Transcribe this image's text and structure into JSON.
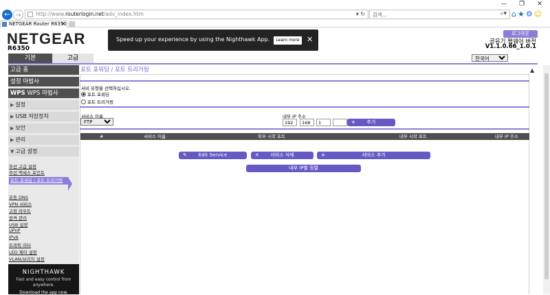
{
  "browser": {
    "url_prefix": "http://www.",
    "url_host": "routerlogin.net",
    "url_path": "/adv_index.htm",
    "search_placeholder": "검색...",
    "tab_title": "NETGEAR Router R6350"
  },
  "header": {
    "logo": "NETGEAR",
    "model": "R6350",
    "banner_text": "Speed up your experience by using the Nighthawk App.",
    "learn_more": "Learn more",
    "logout": "로그아웃",
    "firmware_label": "공유기 펌웨어 버전",
    "firmware_version": "V1.1.0.66_1.0.1",
    "language": "한국어"
  },
  "main_tabs": {
    "basic": "기본",
    "advanced": "고급"
  },
  "sidebar": {
    "home": "고급 홈",
    "setup_wizard": "설정 마법사",
    "wps_wizard": "WPS 마법사",
    "setup": "설정",
    "usb": "USB 저장장치",
    "security": "보안",
    "admin": "관리",
    "advanced_setup": "고급 설정",
    "sub": [
      "무선 고급 설정",
      "무선 액세스 포인트",
      "포트 포워딩 / 포트 트리거링",
      "유동 DNS",
      "VPN 서비스",
      "고정 라우트",
      "원격 관리",
      "USB 설정",
      "UPnP",
      "IPv6",
      "트래픽 미터",
      "LED 제어 설정",
      "VLAN/브리지 설정"
    ]
  },
  "nighthawk": {
    "title": "NIGHTHAWK",
    "subtitle": "Fast and easy control from anywhere.",
    "link": "Download the app now."
  },
  "content": {
    "title": "포트 포워딩 / 포트 트리거링",
    "service_type_label": "서비 유형을 선택하십시오.",
    "opt_forwarding": "포트 포워딩",
    "opt_triggering": "포트 트리거링",
    "service_name_label": "서비스 이름",
    "service_name_value": "FTP",
    "server_ip_label": "내부 IP 주소",
    "ip": [
      "192",
      "168",
      "1",
      ""
    ],
    "add_button": "추가",
    "table_headers": [
      "#",
      "서비스 이름",
      "외부 시작 포트",
      "내부 시작 포트",
      "내부 IP 주소"
    ],
    "edit_button": "Edit Service",
    "delete_button": "서비스 삭제",
    "add_service_button": "서비스 추가",
    "sort_button": "내부 IP별 정렬"
  }
}
